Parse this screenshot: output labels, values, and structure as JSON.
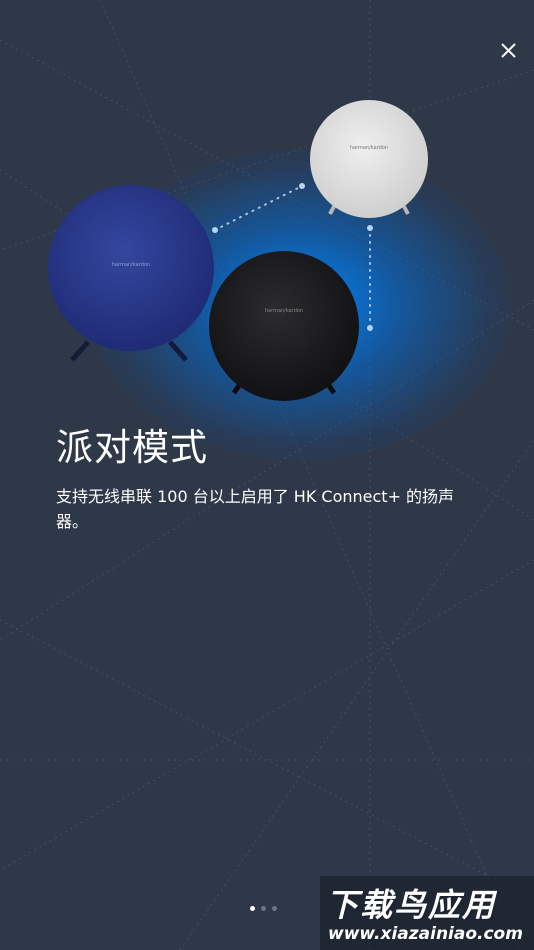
{
  "onboarding": {
    "title": "派对模式",
    "description": "支持无线串联 100 台以上启用了 HK Connect+ 的扬声器。",
    "page_indicator": {
      "total": 3,
      "current": 1
    }
  },
  "icons": {
    "close": "close-icon"
  },
  "speakers": {
    "brand_label": "harman/kardon",
    "colors": [
      "#2a3a8c",
      "#1c1c1e",
      "#e2e2e2"
    ]
  },
  "watermark": {
    "title": "下载鸟应用",
    "url": "www.xiazainiao.com"
  },
  "colors": {
    "background": "#2e3848",
    "glow": "#0a7fff",
    "text": "#ffffff"
  }
}
